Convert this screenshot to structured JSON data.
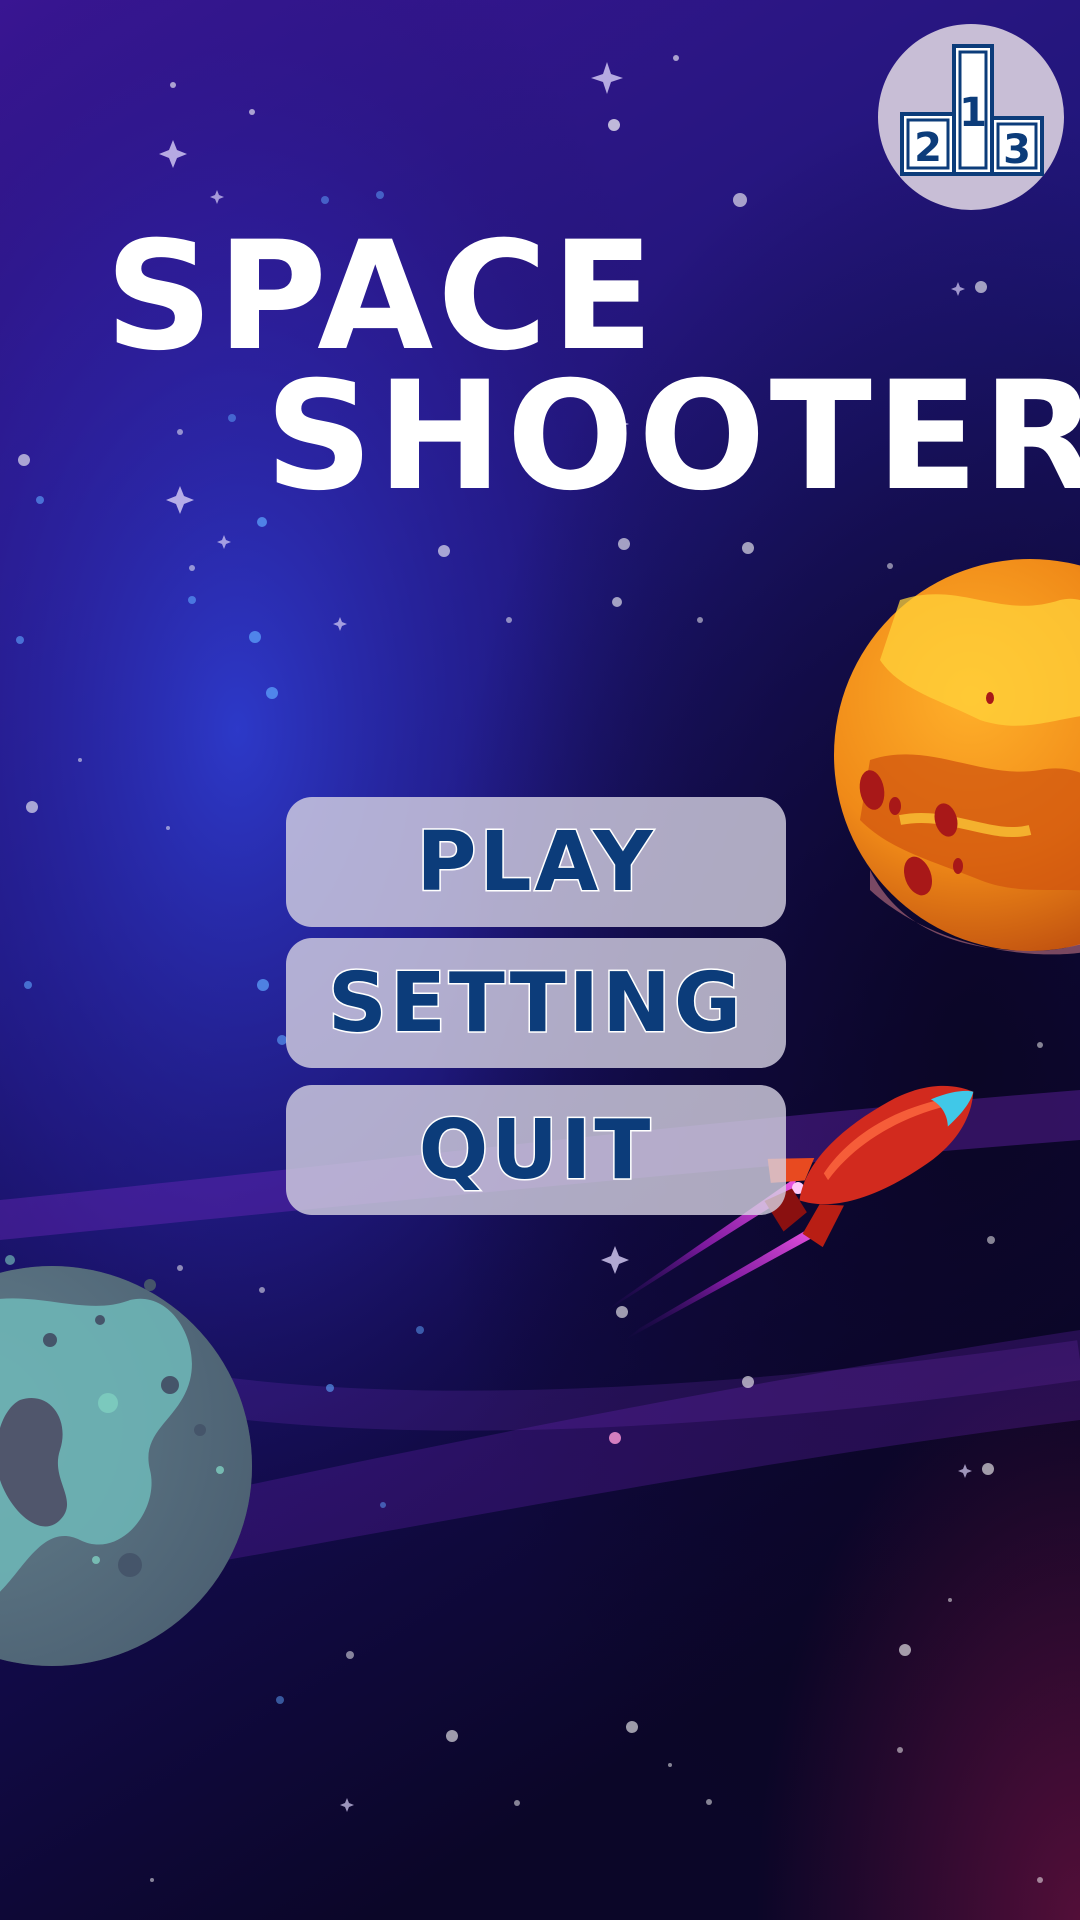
{
  "game": {
    "title_line_1": "SPACE",
    "title_line_2": "SHOOTER"
  },
  "menu": {
    "play_label": "PLAY",
    "setting_label": "SETTING",
    "quit_label": "QUIT"
  },
  "leaderboard": {
    "icon": "podium-icon",
    "first_place": "1",
    "second_place": "2",
    "third_place": "3"
  },
  "colors": {
    "button_text": "#0c3c7a",
    "button_background": "#d6d2e2",
    "title_text": "#ffffff"
  }
}
